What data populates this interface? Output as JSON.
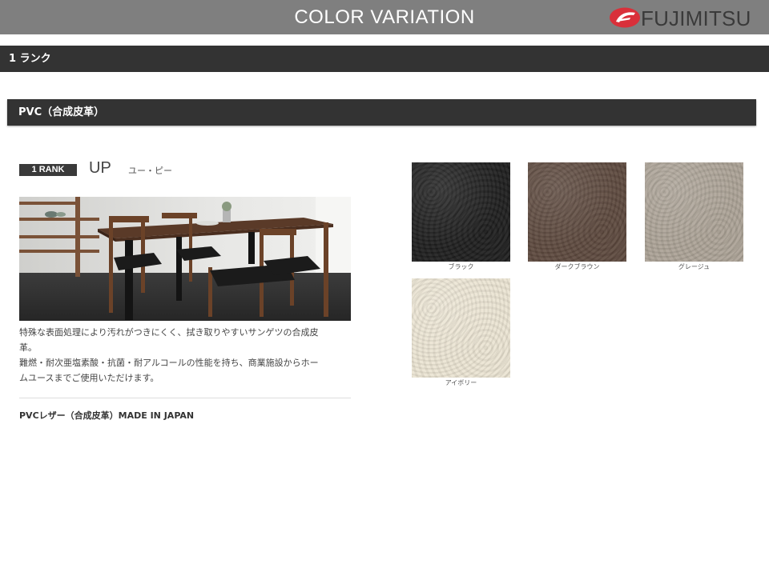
{
  "header": {
    "title": "COLOR VARIATION",
    "logo_text": "FUJIMITSU",
    "logo_color": "#d9303a"
  },
  "section": {
    "rank_heading": "1 ランク",
    "material_heading": "PVC（合成皮革）"
  },
  "product": {
    "rank_badge": "1 RANK",
    "name": "UP",
    "name_kana": "ユー・ピー",
    "description_lines": [
      "特殊な表面処理により汚れがつきにくく、拭き取りやすいサンゲツの合成皮",
      "革。",
      "難燃・耐次亜塩素酸・抗菌・耐アルコールの性能を持ち、商業施設からホー",
      "ムユースまでご使用いただけます。"
    ],
    "origin": "PVCレザー（合成皮革）MADE IN JAPAN"
  },
  "swatches": [
    {
      "label": "ブラック",
      "color": "#1f1f1f"
    },
    {
      "label": "ダークブラウン",
      "color": "#5e4a3f"
    },
    {
      "label": "グレージュ",
      "color": "#aca397"
    },
    {
      "label": "アイボリー",
      "color": "#ebe4d3"
    }
  ]
}
